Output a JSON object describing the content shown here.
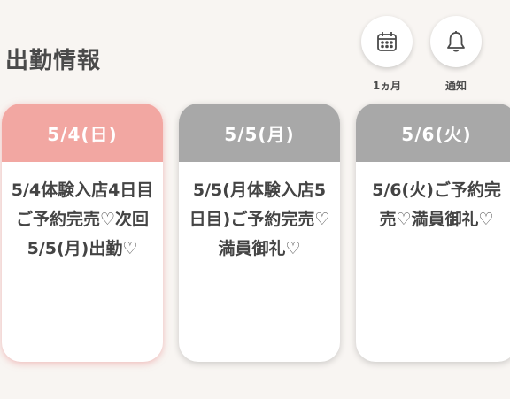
{
  "header": {
    "title": "出勤情報",
    "calendar": {
      "icon": "calendar-icon",
      "label": "1ヵ月"
    },
    "notify": {
      "icon": "bell-icon",
      "label": "通知"
    }
  },
  "cards": [
    {
      "date": "5/4(日)",
      "message": "5/4体験入店4日目ご予約完売♡次回5/5(月)出勤♡",
      "state": "active",
      "color": "#f2a7a2"
    },
    {
      "date": "5/5(月)",
      "message": "5/5(月体験入店5日目)ご予約完売♡満員御礼♡",
      "state": "inactive",
      "color": "#a8a8a8"
    },
    {
      "date": "5/6(火)",
      "message": "5/6(火)ご予約完売♡満員御礼♡",
      "state": "inactive",
      "color": "#a8a8a8"
    }
  ]
}
